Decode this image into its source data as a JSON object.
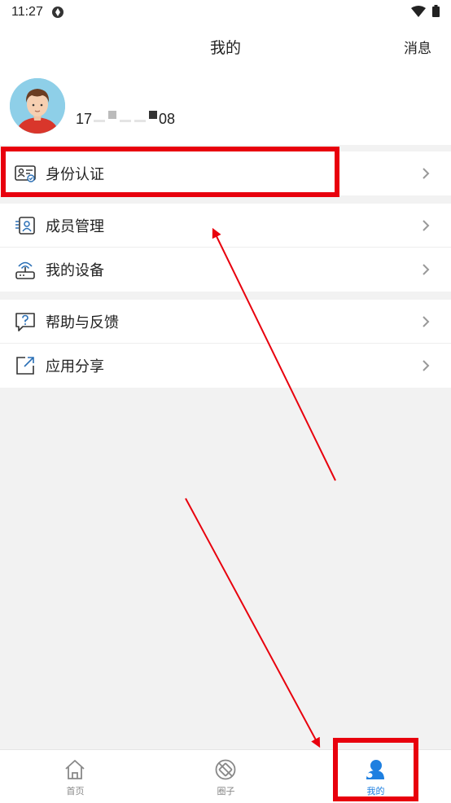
{
  "status_bar": {
    "time": "11:27"
  },
  "header": {
    "title": "我的",
    "message_link": "消息"
  },
  "profile": {
    "phone_prefix": "17",
    "phone_suffix": "08"
  },
  "menu_groups": [
    [
      {
        "label": "身份认证",
        "icon": "id-card-icon"
      }
    ],
    [
      {
        "label": "成员管理",
        "icon": "member-icon"
      },
      {
        "label": "我的设备",
        "icon": "router-icon"
      }
    ],
    [
      {
        "label": "帮助与反馈",
        "icon": "help-icon"
      },
      {
        "label": "应用分享",
        "icon": "share-icon"
      }
    ]
  ],
  "tabs": [
    {
      "label": "首页",
      "icon": "home-icon",
      "active": false
    },
    {
      "label": "圈子",
      "icon": "circle-icon",
      "active": false
    },
    {
      "label": "我的",
      "icon": "user-icon",
      "active": true
    }
  ],
  "colors": {
    "accent": "#1e7fe0",
    "highlight": "#e8000d",
    "icon": "#2a6fb5"
  }
}
